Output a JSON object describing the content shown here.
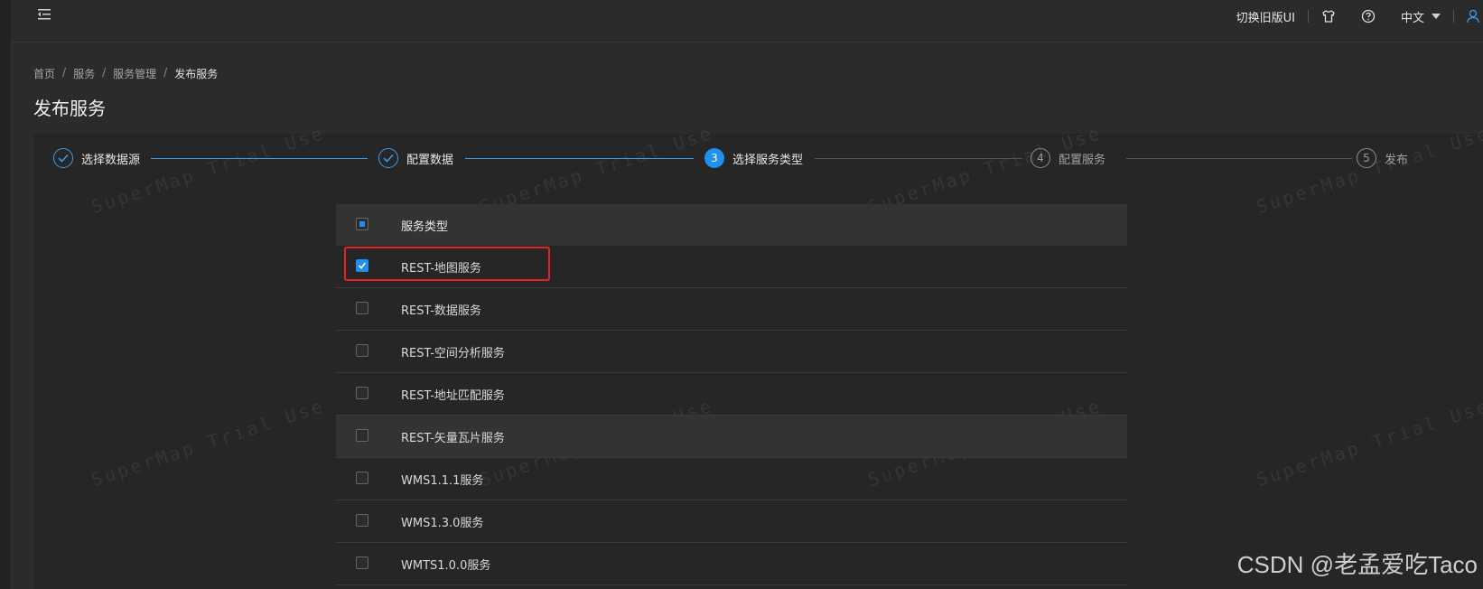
{
  "header": {
    "switch_ui_label": "切换旧版UI",
    "language_label": "中文",
    "icons": [
      "menu-fold-icon",
      "skin-icon",
      "help-icon",
      "user-icon"
    ]
  },
  "breadcrumb": [
    "首页",
    "服务",
    "服务管理",
    "发布服务"
  ],
  "page_title": "发布服务",
  "steps": [
    {
      "number": "",
      "label": "选择数据源",
      "status": "done"
    },
    {
      "number": "",
      "label": "配置数据",
      "status": "done"
    },
    {
      "number": "3",
      "label": "选择服务类型",
      "status": "active"
    },
    {
      "number": "4",
      "label": "配置服务",
      "status": "todo"
    },
    {
      "number": "5",
      "label": "发布",
      "status": "todo"
    }
  ],
  "service_table": {
    "header": "服务类型",
    "header_checkbox": "indeterminate",
    "rows": [
      {
        "label": "REST-地图服务",
        "checked": true
      },
      {
        "label": "REST-数据服务",
        "checked": false
      },
      {
        "label": "REST-空间分析服务",
        "checked": false
      },
      {
        "label": "REST-地址匹配服务",
        "checked": false
      },
      {
        "label": "REST-矢量瓦片服务",
        "checked": false
      },
      {
        "label": "WMS1.1.1服务",
        "checked": false
      },
      {
        "label": "WMS1.3.0服务",
        "checked": false
      },
      {
        "label": "WMTS1.0.0服务",
        "checked": false
      }
    ]
  },
  "watermark_text": "SuperMap Trial Use",
  "footer_mark": "CSDN @老孟爱吃Taco",
  "colors": {
    "accent": "#1f8ff0",
    "highlight": "#e52222",
    "background": "#2b2b2b"
  }
}
